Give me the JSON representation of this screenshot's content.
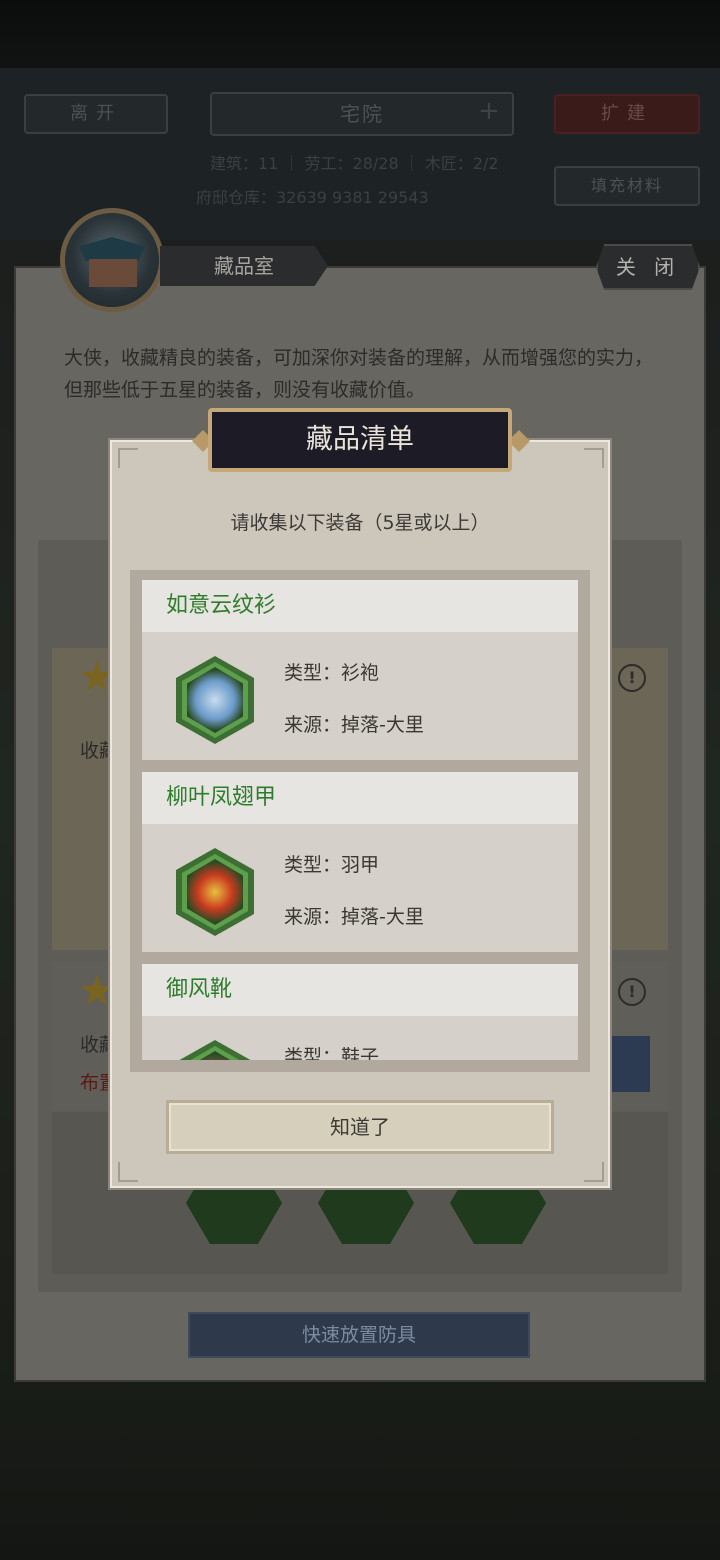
{
  "background": {
    "nav": {
      "leave": "离开",
      "location": "宅院",
      "expand": "扩建",
      "fill_materials": "填充材料"
    },
    "stats": {
      "line1": "建筑：11 ｜ 劳工：28/28 ｜ 木匠：2/2",
      "line2": "府邸仓库：32639      9381      29543"
    },
    "panel": {
      "title": "藏品室",
      "close": "关 闭",
      "description": "大侠，收藏精良的装备，可加深你对装备的理解，从而增强您的实力，但那些低于五星的装备，则没有收藏价值。",
      "row_label_1": "收藏",
      "row_label_2": "收藏",
      "row_label_3": "布置",
      "quick_place": "快速放置防具"
    }
  },
  "modal": {
    "title": "藏品清单",
    "subtitle": "请收集以下装备（5星或以上）",
    "items": [
      {
        "name": "如意云纹衫",
        "type": "类型：衫袍",
        "source": "来源：掉落-大里",
        "icon": "robe-icon"
      },
      {
        "name": "柳叶凤翅甲",
        "type": "类型：羽甲",
        "source": "来源：掉落-大里",
        "icon": "armor-icon"
      },
      {
        "name": "御风靴",
        "type": "类型：鞋子",
        "source": "",
        "icon": "boots-icon"
      }
    ],
    "confirm": "知道了"
  },
  "colors": {
    "item_name": "#2f7d2c",
    "modal_bg": "#cdc6bb",
    "title_bg": "#1d1c26"
  }
}
